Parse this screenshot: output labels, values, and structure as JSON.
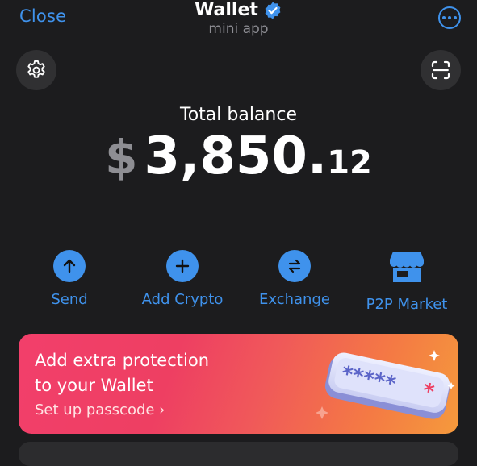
{
  "header": {
    "close_label": "Close",
    "title": "Wallet",
    "subtitle": "mini app",
    "accent_color": "#3f92ec"
  },
  "toolbar": {
    "settings_icon": "gear-icon",
    "scan_icon": "scan-qr-icon"
  },
  "balance": {
    "label": "Total balance",
    "currency": "$",
    "amount": "3,850.",
    "cents": "12"
  },
  "actions": [
    {
      "label": "Send",
      "icon": "arrow-up-icon"
    },
    {
      "label": "Add Crypto",
      "icon": "plus-icon"
    },
    {
      "label": "Exchange",
      "icon": "exchange-arrows-icon"
    },
    {
      "label": "P2P Market",
      "icon": "store-icon"
    }
  ],
  "promo": {
    "title_line1": "Add extra protection",
    "title_line2": "to your Wallet",
    "link": "Set up passcode ›",
    "passcode_art": "*****"
  }
}
